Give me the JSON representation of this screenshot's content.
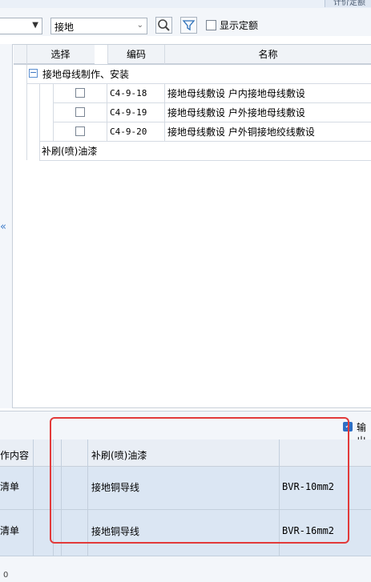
{
  "header_tab": "计价定额",
  "toolbar": {
    "left_combo_value": "",
    "filter_combo_value": "接地",
    "show_quota_label": "显示定额"
  },
  "grid": {
    "columns": [
      "选择",
      "编码",
      "名称"
    ],
    "group_label": "接地母线制作、安装",
    "rows": [
      {
        "code": "C4-9-18",
        "name": "接地母线敷设 户内接地母线敷设"
      },
      {
        "code": "C4-9-19",
        "name": "接地母线敷设 户外接地母线敷设"
      },
      {
        "code": "C4-9-20",
        "name": "接地母线敷设 户外铜接地绞线敷设"
      }
    ],
    "extra_item": "补刷(喷)油漆"
  },
  "output_label": "输出",
  "bottom_table": {
    "header_left": "作内容",
    "header_item": "补刷(喷)油漆",
    "rows": [
      {
        "left": "清单",
        "name": "接地铜导线",
        "spec": "BVR-10mm2"
      },
      {
        "left": "清单",
        "name": "接地铜导线",
        "spec": "BVR-16mm2"
      }
    ]
  },
  "footer_text": "0",
  "colors": {
    "accent": "#2f6fc4",
    "highlight": "#e23a3a",
    "row_bg": "#dbe6f3"
  }
}
